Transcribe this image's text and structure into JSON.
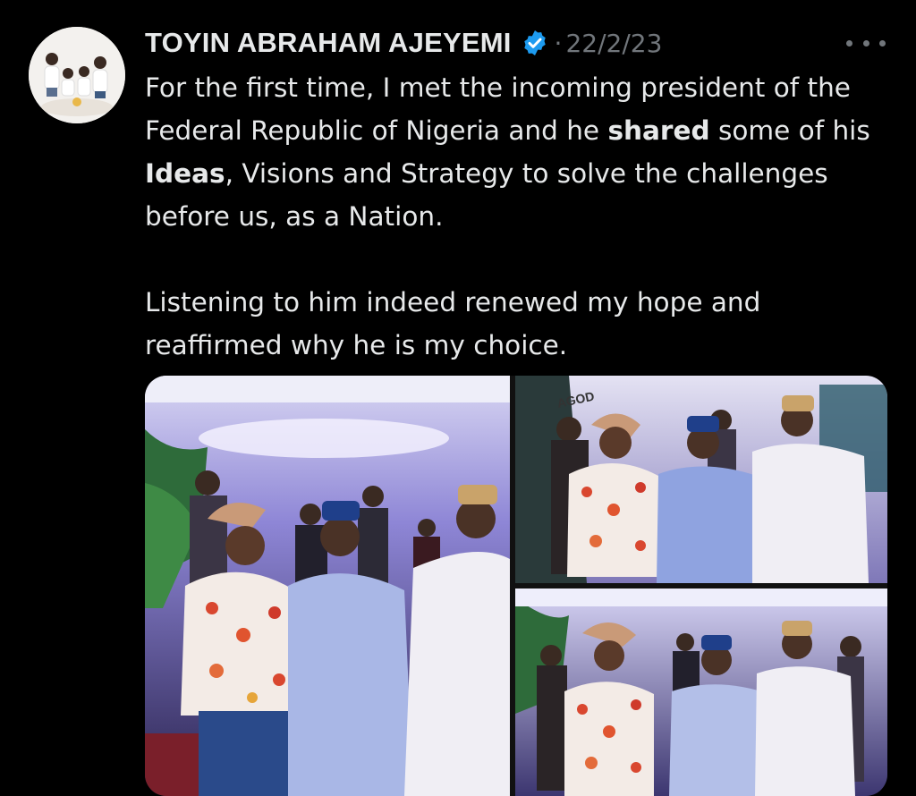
{
  "post": {
    "author_name": "TOYIN ABRAHAM AJEYEMI",
    "date": "22/2/23",
    "separator": "·",
    "paragraph1_parts": [
      "For the first time, I met the incoming president of the Federal Republic of Nigeria and he ",
      "shared",
      " some of his ",
      "Ideas",
      ", Visions and Strategy to solve the challenges before us, as a Nation."
    ],
    "paragraph2": "Listening to him indeed renewed my hope and reaffirmed why he is my choice."
  },
  "icons": {
    "verified": "verified-badge-icon",
    "more": "more-options-icon"
  },
  "colors": {
    "background": "#000000",
    "text": "#e7e9ea",
    "muted": "#71767b",
    "verified_blue": "#1d9bf0"
  },
  "media": {
    "banner_text": "AGOD"
  }
}
